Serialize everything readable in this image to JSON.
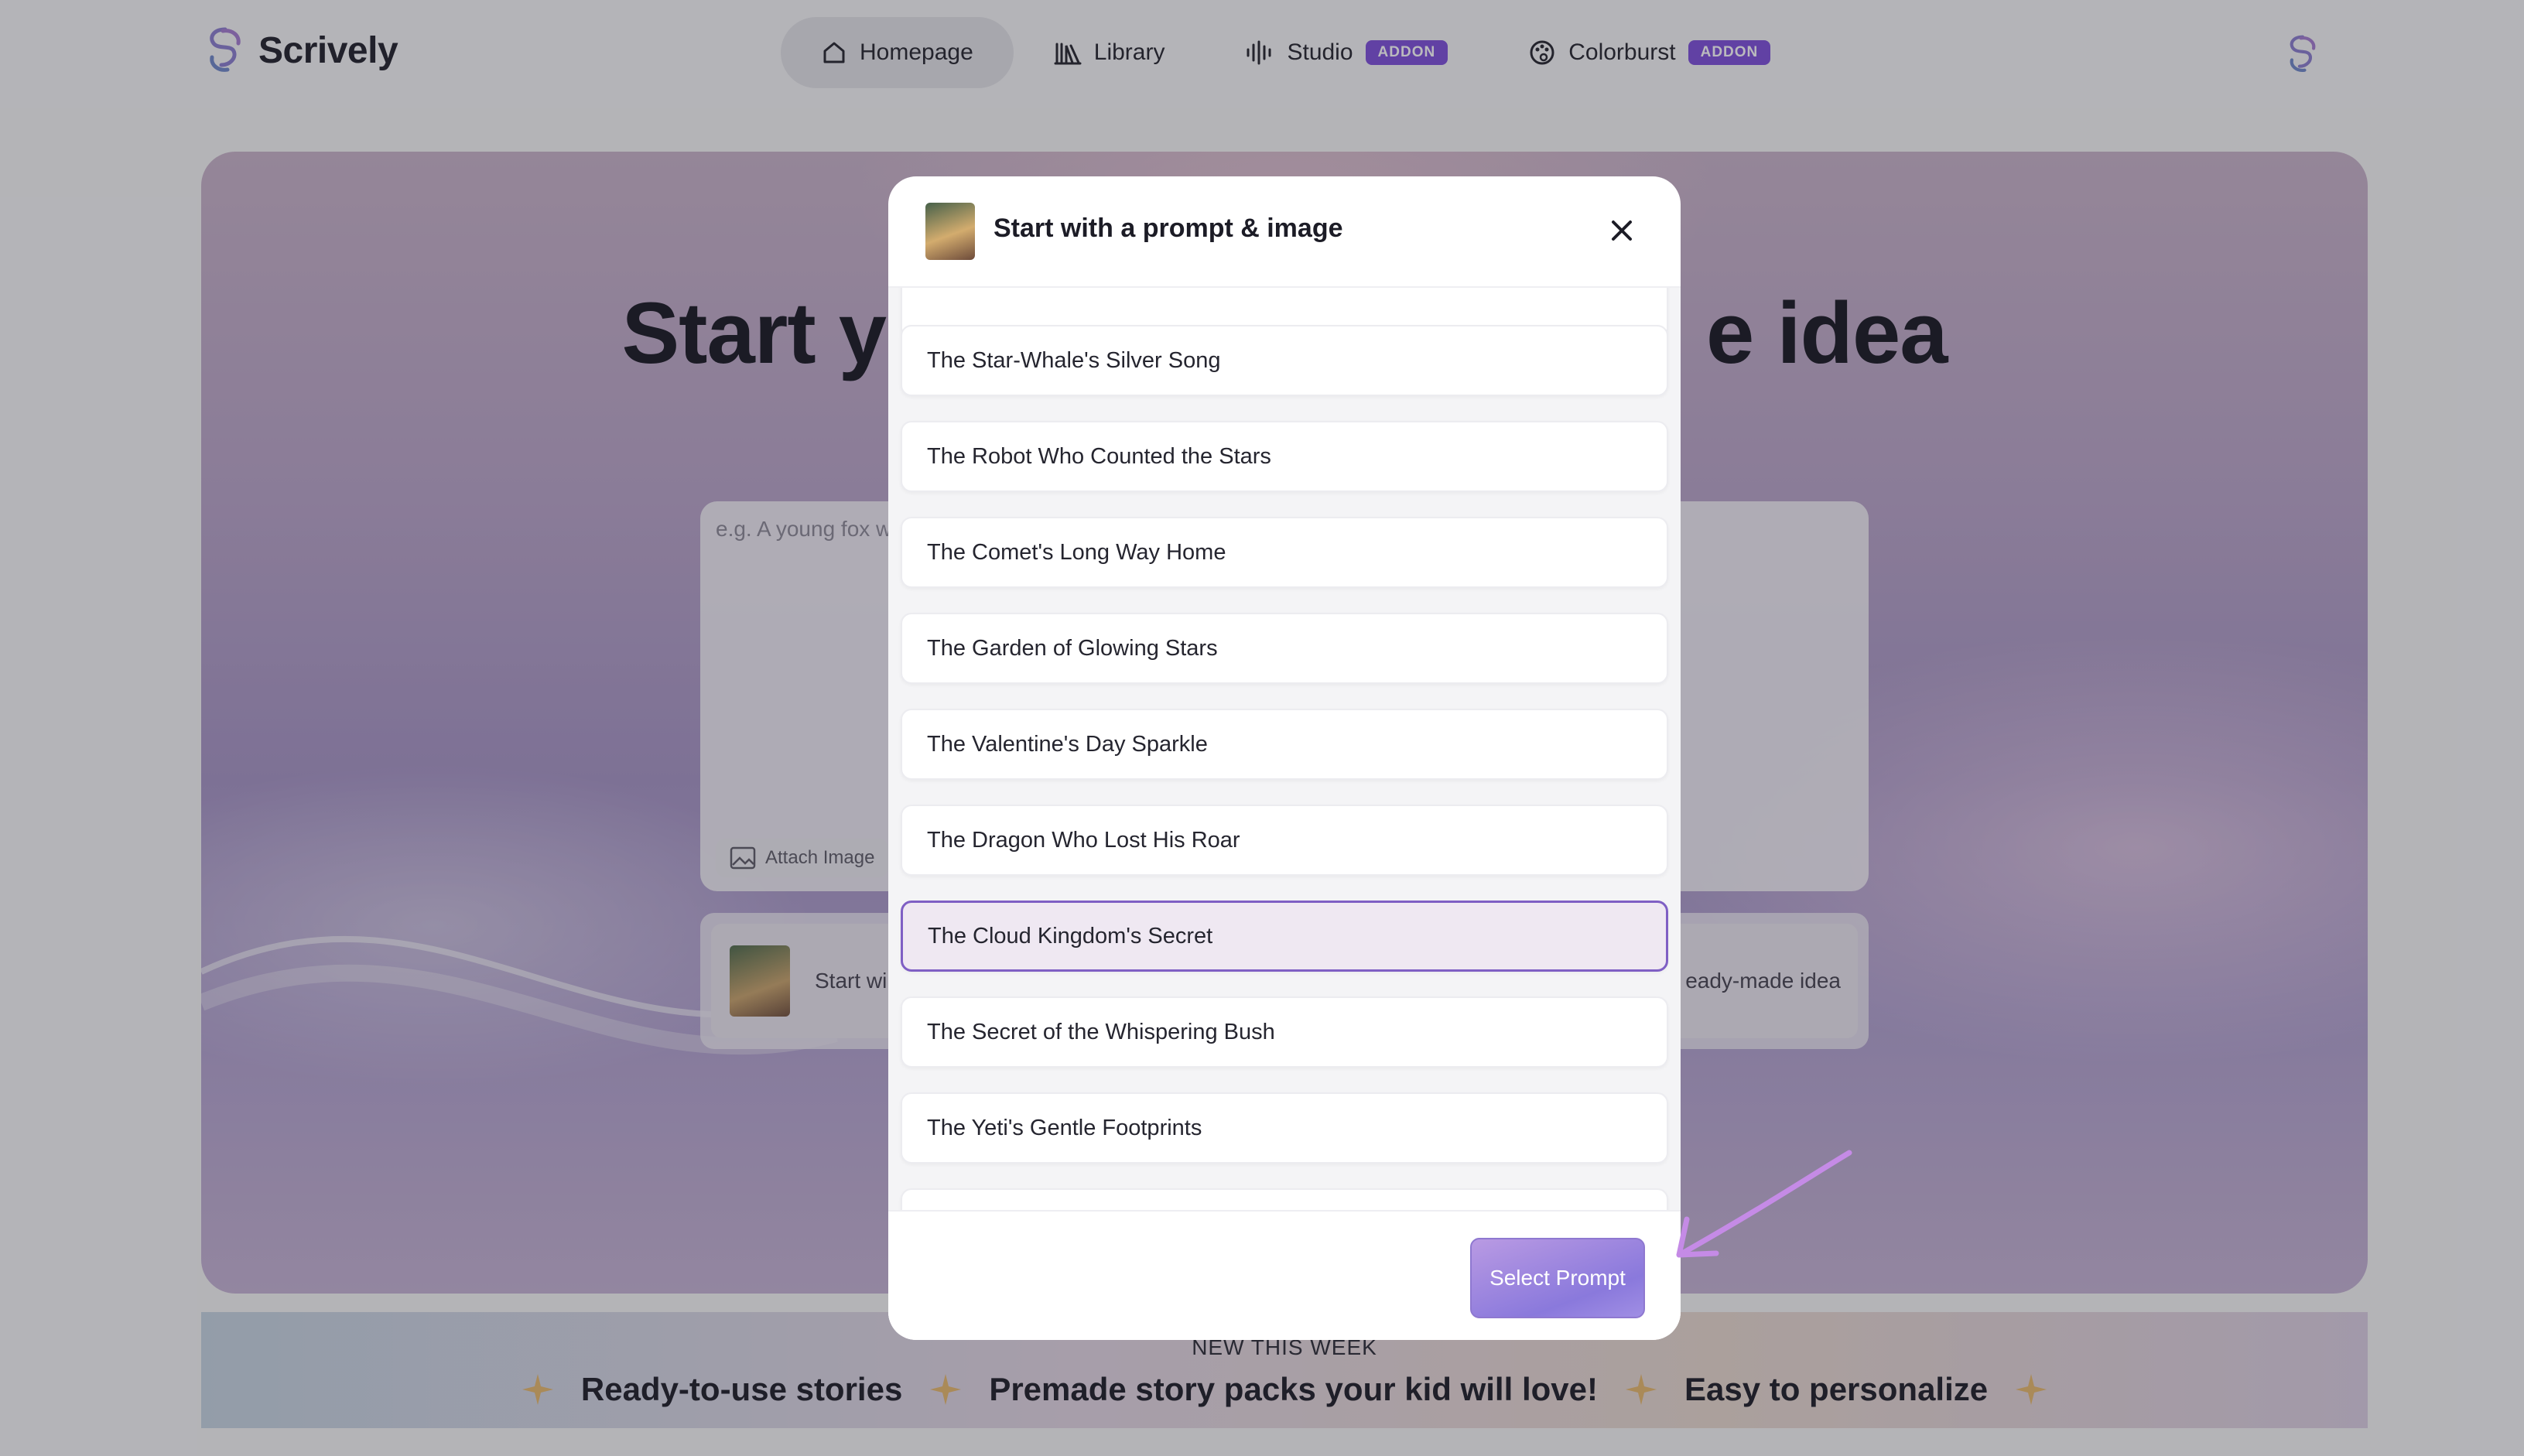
{
  "brand": {
    "name": "Scrively"
  },
  "nav": {
    "items": [
      {
        "label": "Homepage",
        "icon": "home-icon",
        "active": true
      },
      {
        "label": "Library",
        "icon": "library-icon",
        "active": false
      },
      {
        "label": "Studio",
        "icon": "audio-wave-icon",
        "badge": "ADDON",
        "active": false
      },
      {
        "label": "Colorburst",
        "icon": "palette-icon",
        "badge": "ADDON",
        "active": false
      }
    ]
  },
  "hero": {
    "title_left": "Start y",
    "title_right": "e idea",
    "prompt_placeholder": "e.g. A young fox w",
    "attach_label": "Attach Image",
    "starter_left": "Start wi",
    "starter_right": "eady-made idea"
  },
  "banner": {
    "kicker": "NEW THIS WEEK",
    "items": [
      "Ready-to-use stories",
      "Premade story packs your kid will love!",
      "Easy to personalize"
    ]
  },
  "modal": {
    "title": "Start with a prompt & image",
    "prompts": [
      "The Star-Whale's Silver Song",
      "The Robot Who Counted the Stars",
      "The Comet's Long Way Home",
      "The Garden of Glowing Stars",
      "The Valentine's Day Sparkle",
      "The Dragon Who Lost His Roar",
      "The Cloud Kingdom's Secret",
      "The Secret of the Whispering Bush",
      "The Yeti's Gentle Footprints"
    ],
    "selected_prompt": "The Cloud Kingdom's Secret",
    "select_button": "Select Prompt"
  },
  "colors": {
    "accent": "#7c4ddb",
    "selected_border": "#7f5fc4",
    "arrow": "#c58be6"
  }
}
